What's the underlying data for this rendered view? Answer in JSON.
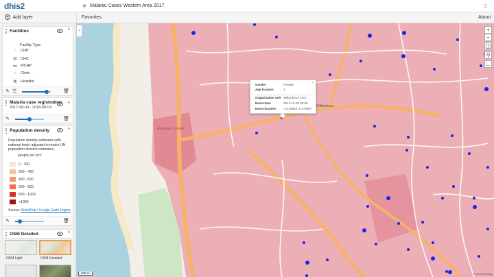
{
  "app": {
    "logo": "dhis2",
    "title": "Malaria: Cases Western Area 2017"
  },
  "toolbar": {
    "add_layer": "Add layer",
    "favorites": "Favorites",
    "about": "About"
  },
  "layers": {
    "facilities": {
      "title": "Facilities",
      "legend_title": "Facility Type",
      "items": [
        {
          "label": "CHP",
          "icon": "house-icon"
        },
        {
          "label": "CHC",
          "icon": "building-icon"
        },
        {
          "label": "MCHP",
          "icon": "ambulance-icon"
        },
        {
          "label": "Clinic",
          "icon": "clinic-icon"
        },
        {
          "label": "Hospital",
          "icon": "hospital-icon"
        }
      ],
      "opacity": 0.8
    },
    "malaria": {
      "title": "Malaria case registration",
      "period": "2017-08-04 - 2018-08-04",
      "opacity": 0.5
    },
    "population": {
      "title": "Population density",
      "description": "Population density estimates with national totals adjusted to match UN population division estimates.",
      "unit": "people per km²",
      "classes": [
        {
          "label": "0 - 200",
          "color": "#fde0d9"
        },
        {
          "label": "200 - 400",
          "color": "#fcbba1"
        },
        {
          "label": "400 - 600",
          "color": "#fc9272"
        },
        {
          "label": "600 - 800",
          "color": "#fb6a4a"
        },
        {
          "label": "800 - 1000",
          "color": "#de2d26"
        },
        {
          "label": ">1000",
          "color": "#a50f15"
        }
      ],
      "source_label": "Source:",
      "source_link": "WorldPop / Google Earth Engine",
      "opacity": 0.15
    },
    "basemap": {
      "title": "OSM Detailed",
      "options": [
        {
          "label": "OSM Light"
        },
        {
          "label": "OSM Detailed"
        }
      ]
    }
  },
  "popup": {
    "rows": [
      {
        "key": "Gender",
        "value": "Female"
      },
      {
        "key": "Age in years",
        "value": "1"
      }
    ],
    "rows2": [
      {
        "key": "Organisation unit",
        "value": "Wilberforce CHC"
      },
      {
        "key": "Event time",
        "value": "2017-12-28 00:00"
      },
      {
        "key": "Event location",
        "value": "-13.26862, 8.474597"
      }
    ]
  },
  "map": {
    "labels": [
      {
        "text": "Wilberforce"
      },
      {
        "text": "Aberdeen Lumley"
      }
    ],
    "scale": "300 m",
    "attribution": "© OpenStreetMap"
  },
  "colors": {
    "event_dot": "#1a27e8",
    "density_fill": "#e99aa4",
    "accent": "#276696"
  }
}
